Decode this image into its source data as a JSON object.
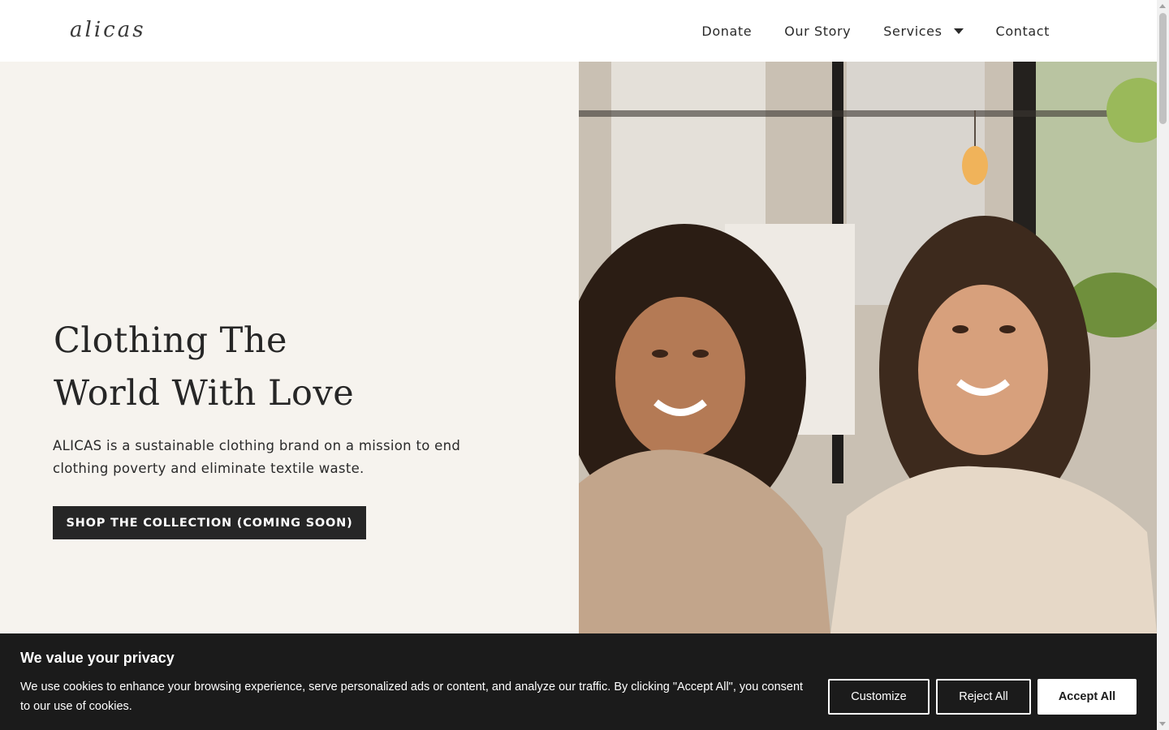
{
  "header": {
    "logo": "alicas",
    "nav": {
      "donate": "Donate",
      "our_story": "Our Story",
      "services": "Services",
      "contact": "Contact"
    }
  },
  "hero": {
    "title_line1": "Clothing The",
    "title_line2": "World With Love",
    "description": "ALICAS is a sustainable clothing brand on a mission to end clothing poverty and eliminate textile waste.",
    "cta": "SHOP THE COLLECTION (COMING SOON)",
    "image_alt": "two-smiling-women-photo"
  },
  "cookie": {
    "title": "We value your privacy",
    "text": "We use cookies to enhance your browsing experience, serve personalized ads or content, and analyze our traffic. By clicking \"Accept All\", you consent to our use of cookies.",
    "customize": "Customize",
    "reject": "Reject All",
    "accept": "Accept All"
  },
  "colors": {
    "hero_bg": "#f6f3ee",
    "dark": "#262626",
    "cookie_bg": "#1b1b1b"
  }
}
